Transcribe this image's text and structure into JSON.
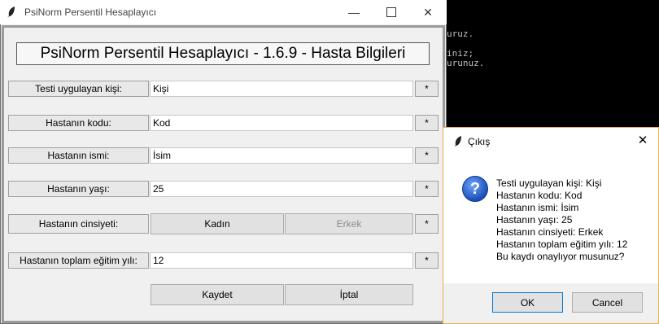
{
  "console": {
    "lines": [
      "uruz.",
      "iniz;",
      "urunuz."
    ]
  },
  "main_window": {
    "title": "PsiNorm Persentil Hesaplayıcı",
    "heading": "PsiNorm Persentil Hesaplayıcı - 1.6.9 - Hasta Bilgileri",
    "fields": {
      "tester": {
        "label": "Testi uygulayan kişi:",
        "value": "Kişi",
        "star": "*"
      },
      "code": {
        "label": "Hastanın kodu:",
        "value": "Kod",
        "star": "*"
      },
      "name": {
        "label": "Hastanın ismi:",
        "value": "İsim",
        "star": "*"
      },
      "age": {
        "label": "Hastanın yaşı:",
        "value": "25",
        "star": "*"
      },
      "gender": {
        "label": "Hastanın cinsiyeti:",
        "female": "Kadın",
        "male": "Erkek",
        "star": "*"
      },
      "education": {
        "label": "Hastanın toplam eğitim yılı:",
        "value": "12",
        "star": "*"
      }
    },
    "save_label": "Kaydet",
    "cancel_label": "İptal"
  },
  "dialog": {
    "title": "Çıkış",
    "lines": [
      "Testi uygulayan kişi: Kişi",
      "Hastanın kodu: Kod",
      "Hastanın ismi: İsim",
      "Hastanın yaşı: 25",
      "Hastanın cinsiyeti: Erkek",
      "Hastanın toplam eğitim yılı: 12",
      "Bu kaydı onaylıyor musunuz?"
    ],
    "ok_label": "OK",
    "cancel_label": "Cancel",
    "icon": "question-icon"
  }
}
